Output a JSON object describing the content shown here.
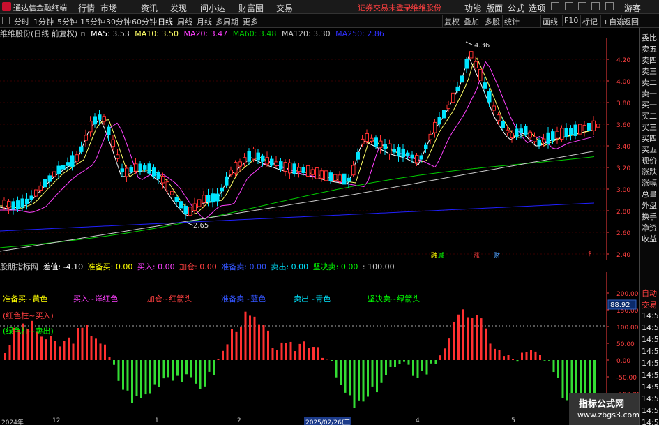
{
  "menubar": {
    "title": "通达信金融终端",
    "items": [
      "行情",
      "市场",
      "资讯",
      "发现",
      "问小达",
      "财富圈",
      "交易"
    ],
    "notice": "证券交易未登录",
    "stock_link": "维维股份",
    "right_items": [
      "功能",
      "版面",
      "公式",
      "选项"
    ],
    "guest": "游客"
  },
  "tfbar": {
    "timeframes": [
      "分时",
      "1分钟",
      "5分钟",
      "15分钟",
      "30分钟",
      "60分钟",
      "日线",
      "周线",
      "月线",
      "多周期",
      "更多"
    ],
    "active": "日线",
    "tools": [
      "复权",
      "叠加",
      "多股",
      "统计",
      "画线",
      "F10",
      "标记",
      "+自选",
      "返回"
    ]
  },
  "main_legend": {
    "stock": "维维股份(日线 前复权)",
    "ma5": "MA5: 3.53",
    "ma10": "MA10: 3.50",
    "ma20": "MA20: 3.47",
    "ma60": "MA60: 3.48",
    "ma120": "MA120: 3.30",
    "ma250": "MA250: 2.86"
  },
  "price_axis": [
    "4.20",
    "4.00",
    "3.80",
    "3.60",
    "3.40",
    "3.20",
    "3.00",
    "2.80",
    "2.60",
    "2.40"
  ],
  "annotations": {
    "high": "4.36",
    "low": "2.65",
    "tags": [
      "融",
      "减",
      "涨",
      "财",
      "$"
    ]
  },
  "indicator_legend": {
    "name": "股朋指标网",
    "diff": "差值: -4.10",
    "prepare_buy": "准备买: 0.00",
    "buy": "买入: 0.00",
    "add": "加仓: 0.00",
    "prepare_sell": "准备卖: 0.00",
    "sell": "卖出: 0.00",
    "firm_sell": "坚决卖: 0.00",
    "hundred": ": 100.00"
  },
  "indicator_labels": {
    "l1": "准备买~黄色",
    "l2": "买入~洋红色",
    "l3": "加仓~红箭头",
    "l4": "准备卖~蓝色",
    "l5": "卖出~青色",
    "l6": "坚决卖~绿箭头",
    "l7": "(红色柱~买入)",
    "l8": "(绿色柱~卖出)"
  },
  "indicator_axis": [
    "200.00",
    "150.00",
    "100.00",
    "50.00",
    "0.00",
    "-50.00",
    "-100.00"
  ],
  "indicator_marker": "88.92",
  "sidebar": {
    "top_items": [
      "委比",
      "卖五",
      "卖四",
      "卖三",
      "卖二",
      "卖一",
      "买一",
      "买二",
      "买三",
      "买四",
      "买五",
      "现价",
      "涨跌",
      "涨幅",
      "总量",
      "外盘",
      "换手",
      "净资",
      "收益"
    ],
    "bottom_items": [
      "自动",
      "交易",
      "14:56",
      "14:56",
      "14:56",
      "14:56",
      "14:56",
      "14:56",
      "14:56",
      "14:56",
      "14:56",
      "14:56",
      "14:56"
    ]
  },
  "timeline": [
    "2024年",
    "12",
    "1",
    "2",
    "2025/02/26(三",
    "4",
    "5"
  ],
  "watermark": {
    "line1": "指标公式网",
    "line2": "www.zbgs3.com"
  },
  "colors": {
    "up": "#ff3030",
    "down": "#00e5ff",
    "ma5": "#ffffff",
    "ma10": "#ffff66",
    "ma20": "#ff40ff",
    "ma60": "#00cc00",
    "ma120": "#cccccc",
    "ma250": "#2020ff"
  }
}
